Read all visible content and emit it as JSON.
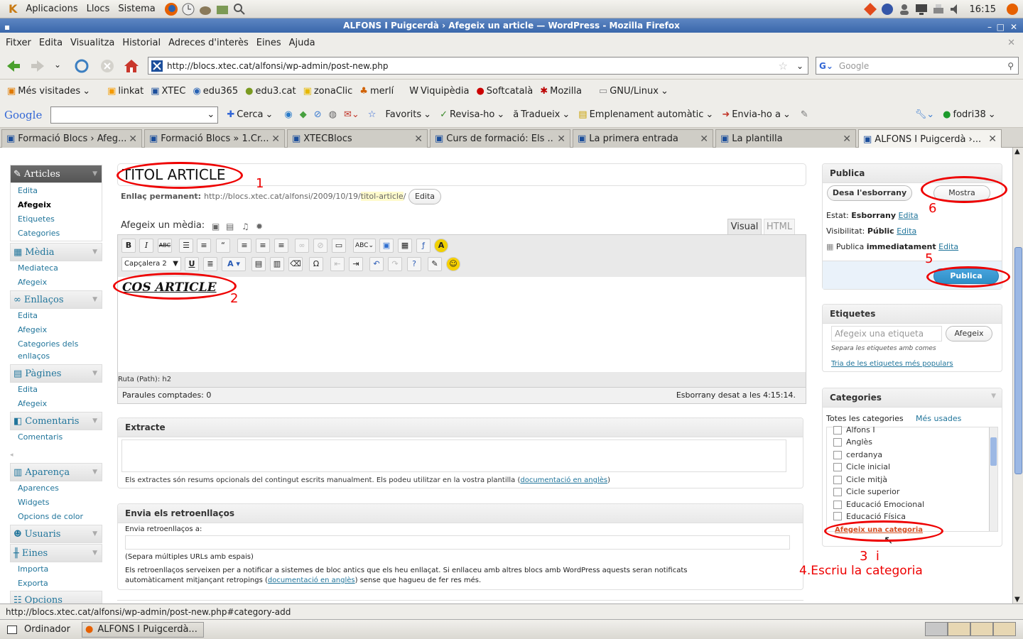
{
  "panel": {
    "menus": [
      "Aplicacions",
      "Llocs",
      "Sistema"
    ],
    "clock": "16:15"
  },
  "window": {
    "title": "ALFONS I Puigcerdà › Afegeix un article — WordPress - Mozilla Firefox"
  },
  "menubar": [
    "Fitxer",
    "Edita",
    "Visualitza",
    "Historial",
    "Adreces d'interès",
    "Eines",
    "Ajuda"
  ],
  "nav": {
    "url": "http://blocs.xtec.cat/alfonsi/wp-admin/post-new.php",
    "search_placeholder": "Google"
  },
  "bookmarks": [
    "Més visitades",
    "linkat",
    "XTEC",
    "edu365",
    "edu3.cat",
    "zonaClic",
    "merlí",
    "Viquipèdia",
    "Softcatalà",
    "Mozilla",
    "GNU/Linux"
  ],
  "googlebar": {
    "logo": "Google",
    "items": [
      "Cerca",
      "Favorits",
      "Revisa-ho",
      "Tradueix",
      "Emplenament automàtic",
      "Envia-ho a"
    ],
    "user": "fodri38"
  },
  "tabs": [
    {
      "title": "Formació Blocs › Afeg..."
    },
    {
      "title": "Formació Blocs » 1.Cr..."
    },
    {
      "title": "XTECBlocs"
    },
    {
      "title": "Curs de formació: Els ..."
    },
    {
      "title": "La primera entrada"
    },
    {
      "title": "La plantilla"
    },
    {
      "title": "ALFONS I Puigcerdà ›..."
    }
  ],
  "sidebar": {
    "articles": {
      "label": "Articles",
      "items": [
        "Edita",
        "Afegeix",
        "Etiquetes",
        "Categories"
      ]
    },
    "media": {
      "label": "Mèdia",
      "items": [
        "Mediateca",
        "Afegeix"
      ]
    },
    "links": {
      "label": "Enllaços",
      "items": [
        "Edita",
        "Afegeix",
        "Categories dels",
        "enllaços"
      ]
    },
    "pages": {
      "label": "Pàgines",
      "items": [
        "Edita",
        "Afegeix"
      ]
    },
    "comments": {
      "label": "Comentaris",
      "items": [
        "Comentaris"
      ]
    },
    "appearance": {
      "label": "Aparença",
      "items": [
        "Aparences",
        "Widgets",
        "Opcions de color"
      ]
    },
    "users": {
      "label": "Usuaris"
    },
    "tools": {
      "label": "Eines",
      "items": [
        "Importa",
        "Exporta"
      ]
    },
    "options": {
      "label": "Opcions"
    }
  },
  "editor": {
    "title": "TITOL ARTICLE",
    "permalink_label": "Enllaç permanent:",
    "permalink_base": "http://blocs.xtec.cat/alfonsi/2009/10/19/",
    "permalink_slug": "titol-article",
    "permalink_end": "/",
    "permalink_edit": "Edita",
    "media_label": "Afegeix un mèdia:",
    "tab_visual": "Visual",
    "tab_html": "HTML",
    "format_select": "Capçalera 2",
    "body": "COS ARTICLE",
    "path": "Ruta (Path): h2",
    "word_count": "Paraules comptades: 0",
    "draft_saved": "Esborrany desat a les 4:15:14."
  },
  "excerpt": {
    "title": "Extracte",
    "help": "Els extractes són resums opcionals del contingut escrits manualment. Els podeu utilitzar en la vostra plantilla (",
    "help_link": "documentació en anglès",
    "help_end": ")"
  },
  "trackbacks": {
    "title": "Envia els retroenllaços",
    "label": "Envia retroenllaços a:",
    "hint": "(Separa múltiples URLs amb espais)",
    "desc1": "Els retroenllaços serveixen per a notificar a sistemes de bloc antics que els heu enllaçat. Si enllaceu amb altres blocs amb WordPress aquests seran notificats",
    "desc2": "automàticament mitjançant retropings (",
    "desc_link": "documentació en anglès",
    "desc3": ") sense que hagueu de fer res més."
  },
  "publish": {
    "title": "Publica",
    "save_draft": "Desa l'esborrany",
    "preview": "Mostra",
    "status_label": "Estat:",
    "status_value": "Esborrany",
    "visibility_label": "Visibilitat:",
    "visibility_value": "Públic",
    "schedule_label": "Publica",
    "schedule_value": "immediatament",
    "edit": "Edita",
    "publish_button": "Publica"
  },
  "tags": {
    "title": "Etiquetes",
    "placeholder": "Afegeix una etiqueta",
    "add": "Afegeix",
    "hint": "Separa les etiquetes amb comes",
    "popular": "Tria de les etiquetes més populars"
  },
  "categories": {
    "title": "Categories",
    "tab_all": "Totes les categories",
    "tab_most": "Més usades",
    "items": [
      "Alfons I",
      "Anglès",
      "cerdanya",
      "Cicle inicial",
      "Cicle mitjà",
      "Cicle superior",
      "Educació Emocional",
      "Educació Física"
    ],
    "add_link": "Afegeix una categoria"
  },
  "annotations": {
    "n1": "1",
    "n2": "2",
    "n3": "3  i",
    "n4": "4.Escriu la categoria",
    "n5": "5",
    "n6": "6"
  },
  "status_url": "http://blocs.xtec.cat/alfonsi/wp-admin/post-new.php#category-add",
  "taskbar": {
    "computer": "Ordinador",
    "window": "ALFONS I Puigcerdà..."
  },
  "colors": {
    "wp_link": "#21759b",
    "annotation": "#e00000",
    "publish_button": "#2e8fc6",
    "titlebar": "#3a67ab"
  }
}
